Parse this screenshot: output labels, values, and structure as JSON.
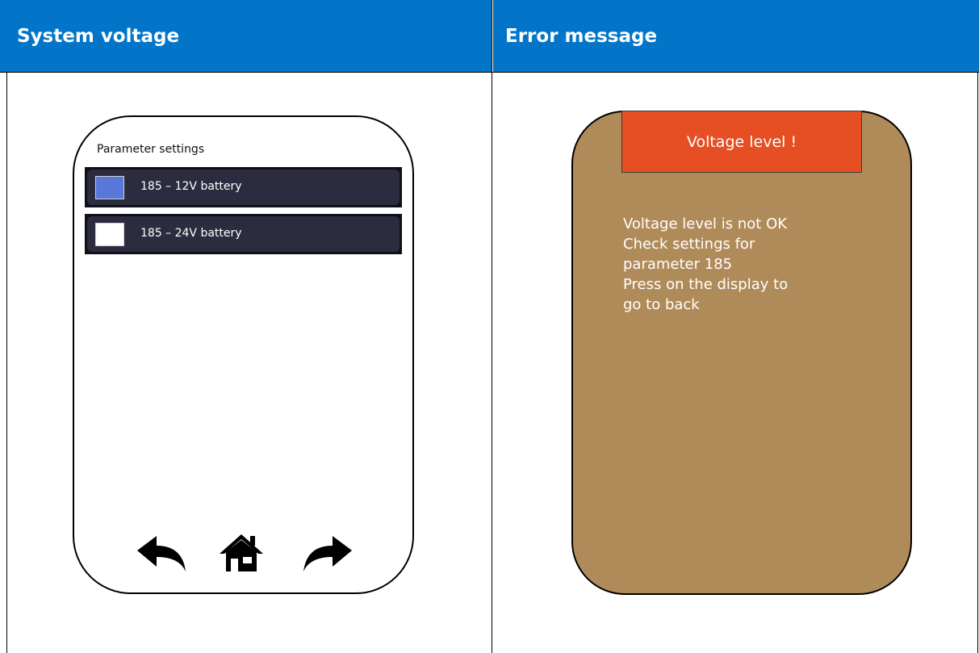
{
  "table": {
    "col1_header": "System voltage",
    "col2_header": "Error message"
  },
  "parameter_screen": {
    "title": "Parameter settings",
    "options": [
      {
        "label": "185 – 12V battery",
        "selected": true,
        "checkbox_color": "#5877d9"
      },
      {
        "label": "185 – 24V battery",
        "selected": false,
        "checkbox_color": "#ffffff"
      }
    ],
    "nav": {
      "back_icon": "arrow-left-icon",
      "home_icon": "home-icon",
      "forward_icon": "arrow-right-icon"
    }
  },
  "error_screen": {
    "title": "Voltage level !",
    "lines": [
      "Voltage level is not OK",
      "Check settings for",
      "parameter 185",
      "Press on the display to",
      "go to back"
    ]
  },
  "colors": {
    "header_blue": "#0375c9",
    "error_red": "#e54f23",
    "error_bg": "#b08b5a",
    "option_bg": "#2c2c40"
  }
}
